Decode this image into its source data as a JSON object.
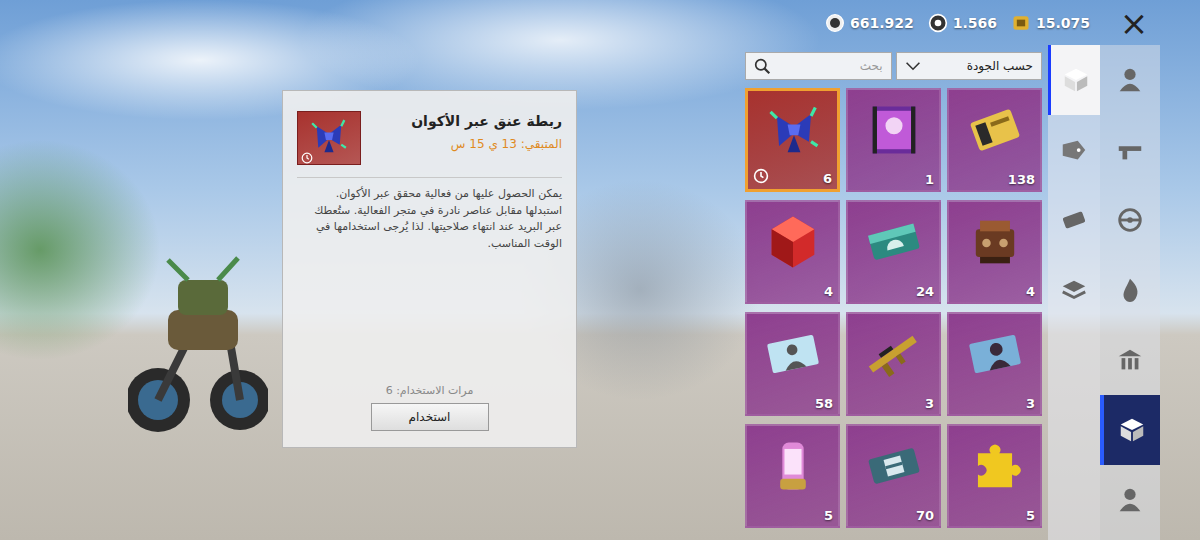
{
  "currencies": [
    {
      "kind": "bp",
      "value": "661.922"
    },
    {
      "kind": "ag",
      "value": "1.566"
    },
    {
      "kind": "uc",
      "value": "15.075"
    }
  ],
  "close": "×",
  "search": {
    "placeholder": "بحث"
  },
  "sort": {
    "label": "حسب الجودة"
  },
  "items": [
    {
      "kind": "tie",
      "count": "6",
      "color": "#a8322e",
      "selected": true,
      "timed": true
    },
    {
      "kind": "video",
      "count": "1",
      "color": "#8e3f8f",
      "selected": false,
      "timed": false
    },
    {
      "kind": "ticket",
      "count": "138",
      "color": "#8e3f8f",
      "selected": false,
      "timed": false
    },
    {
      "kind": "gem",
      "count": "4",
      "color": "#8e3f8f",
      "selected": false,
      "timed": false
    },
    {
      "kind": "pass",
      "count": "24",
      "color": "#8e3f8f",
      "selected": false,
      "timed": false
    },
    {
      "kind": "engine",
      "count": "4",
      "color": "#8e3f8f",
      "selected": false,
      "timed": false
    },
    {
      "kind": "card",
      "count": "58",
      "color": "#8e3f8f",
      "selected": false,
      "timed": false
    },
    {
      "kind": "gun",
      "count": "3",
      "color": "#8e3f8f",
      "selected": false,
      "timed": false
    },
    {
      "kind": "portrait",
      "count": "3",
      "color": "#8e3f8f",
      "selected": false,
      "timed": false
    },
    {
      "kind": "capsule",
      "count": "5",
      "color": "#8e3f8f",
      "selected": false,
      "timed": false
    },
    {
      "kind": "coupon",
      "count": "70",
      "color": "#8e3f8f",
      "selected": false,
      "timed": false
    },
    {
      "kind": "puzzle",
      "count": "5",
      "color": "#8e3f8f",
      "selected": false,
      "timed": false
    }
  ],
  "detail": {
    "kind": "tie",
    "color": "#a8322e",
    "timed": true,
    "title": "ربطة عنق عبر الأكوان",
    "remaining": "المتبقي: 13 ي 15 س",
    "description": "يمكن الحصول عليها من فعالية محقق عبر الأكوان. استبدلها مقابل عناصر نادرة في متجر الفعالية. ستُعطك عبر البريد عند انتهاء صلاحيتها. لذا يُرجى استخدامها في الوقت المناسب.",
    "uses": "مرات الاستخدام: 6",
    "button": "استخدام"
  },
  "sub_nav": [
    {
      "kind": "box",
      "selected": true
    },
    {
      "kind": "sale",
      "selected": false
    },
    {
      "kind": "ticket",
      "selected": false
    },
    {
      "kind": "layers",
      "selected": false
    }
  ],
  "main_nav": [
    {
      "kind": "person",
      "selected": false
    },
    {
      "kind": "gun",
      "selected": false
    },
    {
      "kind": "wheel",
      "selected": false
    },
    {
      "kind": "flame",
      "selected": false
    },
    {
      "kind": "building",
      "selected": false
    },
    {
      "kind": "box",
      "selected": true
    },
    {
      "kind": "person",
      "selected": false
    }
  ]
}
